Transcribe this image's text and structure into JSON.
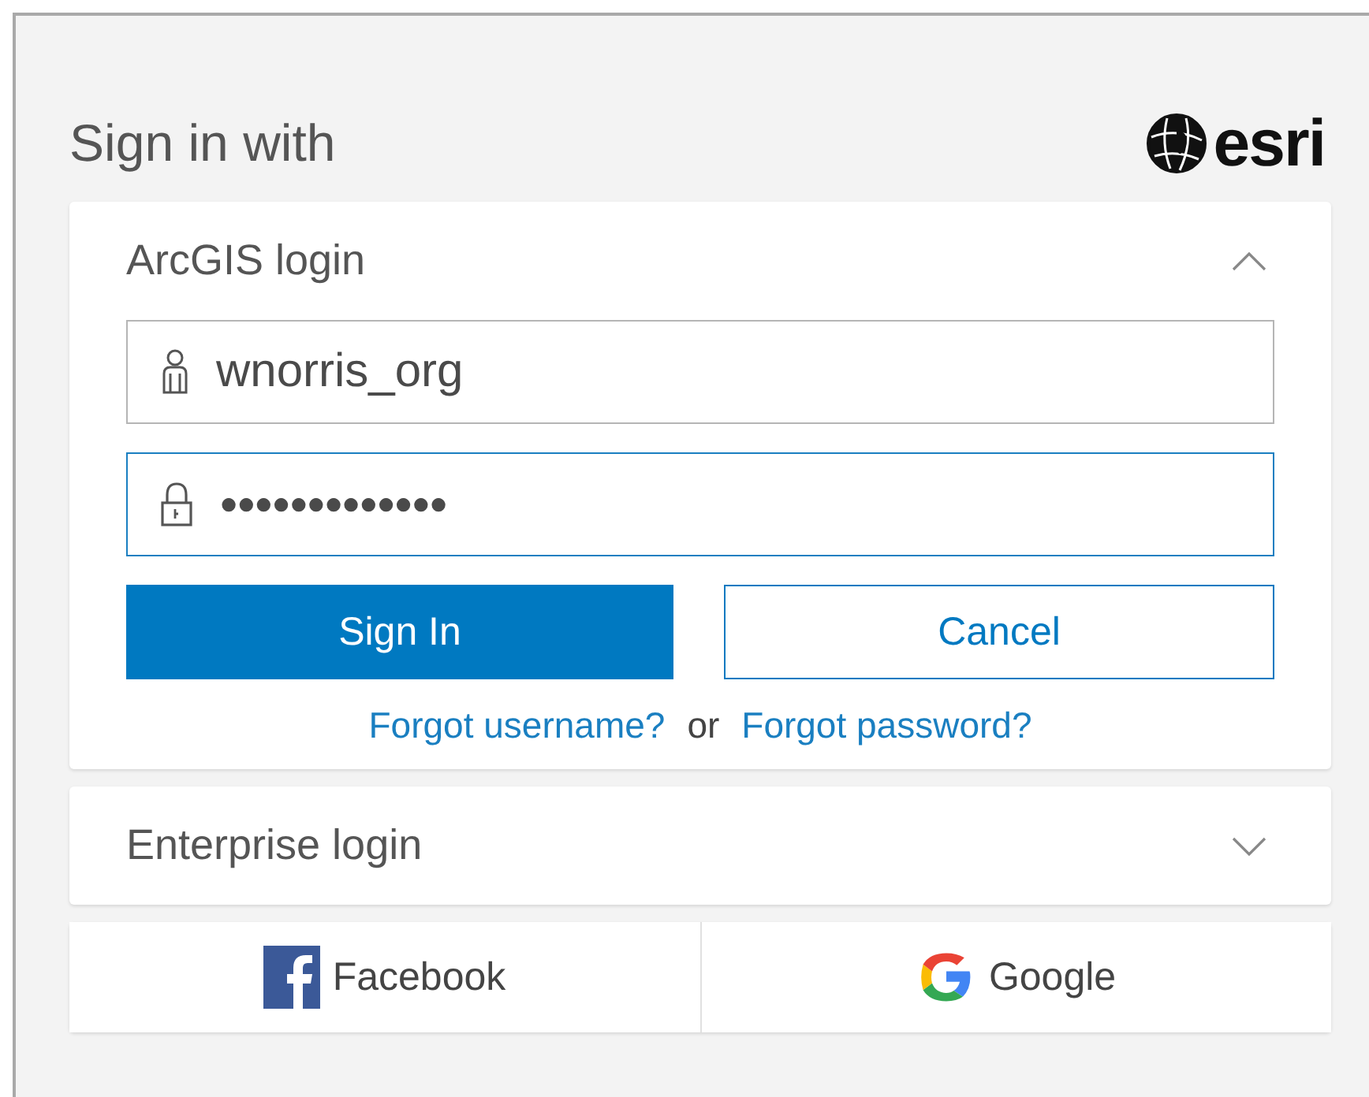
{
  "header": {
    "title": "Sign in with",
    "logo_text": "esri"
  },
  "sections": [
    {
      "title": "ArcGIS login",
      "expanded": true,
      "fields": [
        {
          "kind": "user",
          "value": "wnorris_org",
          "focused": false
        },
        {
          "kind": "lock",
          "value": "●●●●●●●●●●●●●",
          "focused": true
        }
      ],
      "buttons": [
        {
          "label": "Sign In",
          "primary": true
        },
        {
          "label": "Cancel",
          "primary": false
        }
      ],
      "links": {
        "username": "Forgot username?",
        "or": "or",
        "password": "Forgot password?"
      }
    },
    {
      "title": "Enterprise login",
      "expanded": false
    }
  ],
  "social": [
    {
      "kind": "facebook",
      "label": "Facebook"
    },
    {
      "kind": "google",
      "label": "Google"
    }
  ]
}
